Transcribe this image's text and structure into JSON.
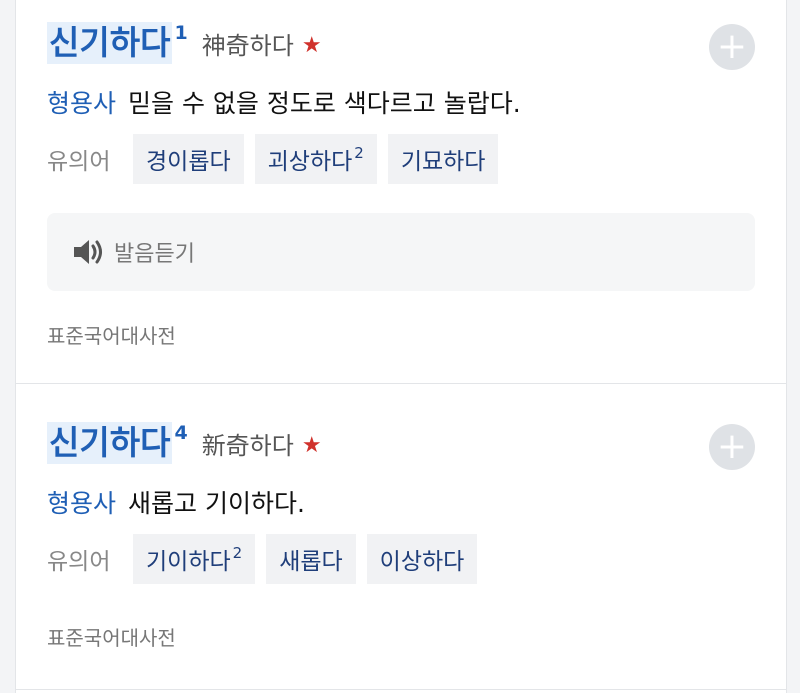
{
  "entries": [
    {
      "headword": "신기하다",
      "homonym_number": "1",
      "hanja": "神奇하다",
      "star_icon": "star-icon",
      "add_icon": "plus-icon",
      "part_of_speech": "형용사",
      "definition": "믿을 수 없을 정도로 색다르고 놀랍다.",
      "synonym_label": "유의어",
      "synonyms": [
        {
          "word": "경이롭다",
          "num": ""
        },
        {
          "word": "괴상하다",
          "num": "2"
        },
        {
          "word": "기묘하다",
          "num": ""
        }
      ],
      "audio_label": "발음듣기",
      "source": "표준국어대사전"
    },
    {
      "headword": "신기하다",
      "homonym_number": "4",
      "hanja": "新奇하다",
      "star_icon": "star-icon",
      "add_icon": "plus-icon",
      "part_of_speech": "형용사",
      "definition": "새롭고 기이하다.",
      "synonym_label": "유의어",
      "synonyms": [
        {
          "word": "기이하다",
          "num": "2"
        },
        {
          "word": "새롭다",
          "num": ""
        },
        {
          "word": "이상하다",
          "num": ""
        }
      ],
      "source": "표준국어대사전"
    }
  ],
  "colors": {
    "headword": "#1f5fb5",
    "headword_bg": "#e6f0fb",
    "star": "#d0322c",
    "synonym_text": "#1f3e7a"
  }
}
